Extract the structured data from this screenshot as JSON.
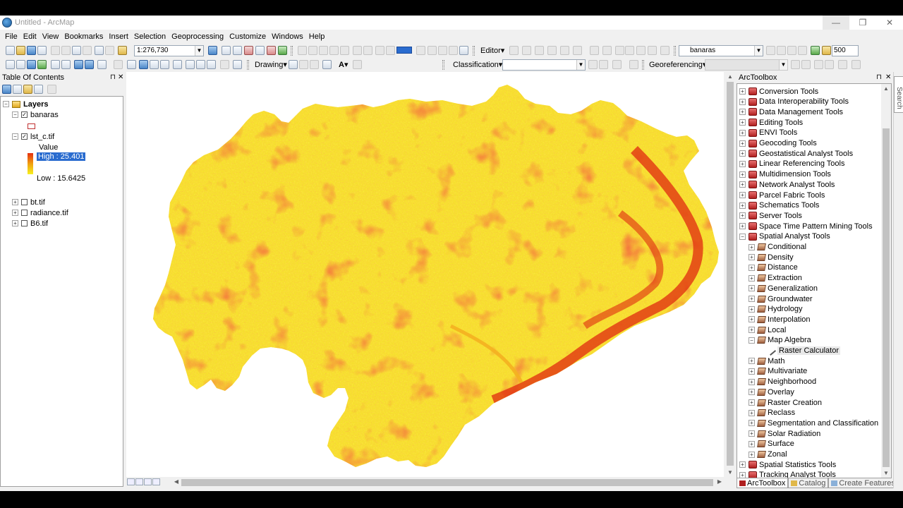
{
  "window": {
    "title": "Untitled - ArcMap",
    "controls": {
      "minimize": "—",
      "restore": "❐",
      "close": "✕"
    }
  },
  "menu": [
    "File",
    "Edit",
    "View",
    "Bookmarks",
    "Insert",
    "Selection",
    "Geoprocessing",
    "Customize",
    "Windows",
    "Help"
  ],
  "toolbar": {
    "scale": "1:276,730",
    "editor_label": "Editor▾",
    "target_layer": "banaras",
    "zoom_value": "500",
    "drawing_label": "Drawing▾",
    "text_tool": "A▾",
    "classification_label": "Classification▾",
    "classification_value": "",
    "georeferencing_label": "Georeferencing▾",
    "georeferencing_value": ""
  },
  "toc": {
    "title": "Table Of Contents",
    "pin": "⊓",
    "close": "✕",
    "layers_label": "Layers",
    "layers": [
      {
        "name": "banaras",
        "checked": "✓",
        "expanded": "−"
      },
      {
        "name": "lst_c.tif",
        "checked": "✓",
        "expanded": "−"
      },
      {
        "name": "bt.tif",
        "checked": "",
        "expanded": "+"
      },
      {
        "name": "radiance.tif",
        "checked": "",
        "expanded": "+"
      },
      {
        "name": "B6.tif",
        "checked": "",
        "expanded": "+"
      }
    ],
    "legend": {
      "value_label": "Value",
      "high": "High : 25.401",
      "low": "Low : 15.6425"
    }
  },
  "toolbox": {
    "title": "ArcToolbox",
    "pin": "⊓",
    "close": "✕",
    "items": [
      {
        "label": "Conversion Tools",
        "level": 0,
        "kind": "toolbox",
        "exp": "+"
      },
      {
        "label": "Data Interoperability Tools",
        "level": 0,
        "kind": "toolbox",
        "exp": "+"
      },
      {
        "label": "Data Management Tools",
        "level": 0,
        "kind": "toolbox",
        "exp": "+"
      },
      {
        "label": "Editing Tools",
        "level": 0,
        "kind": "toolbox",
        "exp": "+"
      },
      {
        "label": "ENVI Tools",
        "level": 0,
        "kind": "toolbox",
        "exp": "+"
      },
      {
        "label": "Geocoding Tools",
        "level": 0,
        "kind": "toolbox",
        "exp": "+"
      },
      {
        "label": "Geostatistical Analyst Tools",
        "level": 0,
        "kind": "toolbox",
        "exp": "+"
      },
      {
        "label": "Linear Referencing Tools",
        "level": 0,
        "kind": "toolbox",
        "exp": "+"
      },
      {
        "label": "Multidimension Tools",
        "level": 0,
        "kind": "toolbox",
        "exp": "+"
      },
      {
        "label": "Network Analyst Tools",
        "level": 0,
        "kind": "toolbox",
        "exp": "+"
      },
      {
        "label": "Parcel Fabric Tools",
        "level": 0,
        "kind": "toolbox",
        "exp": "+"
      },
      {
        "label": "Schematics Tools",
        "level": 0,
        "kind": "toolbox",
        "exp": "+"
      },
      {
        "label": "Server Tools",
        "level": 0,
        "kind": "toolbox",
        "exp": "+"
      },
      {
        "label": "Space Time Pattern Mining Tools",
        "level": 0,
        "kind": "toolbox",
        "exp": "+"
      },
      {
        "label": "Spatial Analyst Tools",
        "level": 0,
        "kind": "toolbox",
        "exp": "−"
      },
      {
        "label": "Conditional",
        "level": 1,
        "kind": "toolset",
        "exp": "+"
      },
      {
        "label": "Density",
        "level": 1,
        "kind": "toolset",
        "exp": "+"
      },
      {
        "label": "Distance",
        "level": 1,
        "kind": "toolset",
        "exp": "+"
      },
      {
        "label": "Extraction",
        "level": 1,
        "kind": "toolset",
        "exp": "+"
      },
      {
        "label": "Generalization",
        "level": 1,
        "kind": "toolset",
        "exp": "+"
      },
      {
        "label": "Groundwater",
        "level": 1,
        "kind": "toolset",
        "exp": "+"
      },
      {
        "label": "Hydrology",
        "level": 1,
        "kind": "toolset",
        "exp": "+"
      },
      {
        "label": "Interpolation",
        "level": 1,
        "kind": "toolset",
        "exp": "+"
      },
      {
        "label": "Local",
        "level": 1,
        "kind": "toolset",
        "exp": "+"
      },
      {
        "label": "Map Algebra",
        "level": 1,
        "kind": "toolset",
        "exp": "−"
      },
      {
        "label": "Raster Calculator",
        "level": 2,
        "kind": "tool",
        "exp": ""
      },
      {
        "label": "Math",
        "level": 1,
        "kind": "toolset",
        "exp": "+"
      },
      {
        "label": "Multivariate",
        "level": 1,
        "kind": "toolset",
        "exp": "+"
      },
      {
        "label": "Neighborhood",
        "level": 1,
        "kind": "toolset",
        "exp": "+"
      },
      {
        "label": "Overlay",
        "level": 1,
        "kind": "toolset",
        "exp": "+"
      },
      {
        "label": "Raster Creation",
        "level": 1,
        "kind": "toolset",
        "exp": "+"
      },
      {
        "label": "Reclass",
        "level": 1,
        "kind": "toolset",
        "exp": "+"
      },
      {
        "label": "Segmentation and Classification",
        "level": 1,
        "kind": "toolset",
        "exp": "+"
      },
      {
        "label": "Solar Radiation",
        "level": 1,
        "kind": "toolset",
        "exp": "+"
      },
      {
        "label": "Surface",
        "level": 1,
        "kind": "toolset",
        "exp": "+"
      },
      {
        "label": "Zonal",
        "level": 1,
        "kind": "toolset",
        "exp": "+"
      },
      {
        "label": "Spatial Statistics Tools",
        "level": 0,
        "kind": "toolbox",
        "exp": "+"
      },
      {
        "label": "Tracking Analyst Tools",
        "level": 0,
        "kind": "toolbox",
        "exp": "+"
      }
    ],
    "tabs": [
      "ArcToolbox",
      "Catalog",
      "Create Features"
    ]
  },
  "search_tab": "Search",
  "colors": {
    "raster_low": "#f6f020",
    "raster_mid": "#f0a010",
    "raster_high": "#e53010",
    "selection": "#2a6ccf"
  }
}
